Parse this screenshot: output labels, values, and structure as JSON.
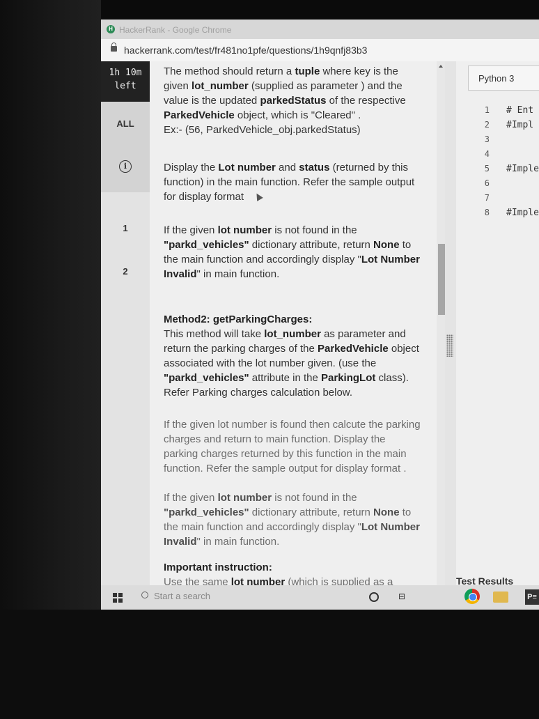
{
  "browser": {
    "window_title": "HackerRank - Google Chrome",
    "logo_letter": "H",
    "url": "hackerrank.com/test/fr481no1pfe/questions/1h9qnfj83b3"
  },
  "sidebar": {
    "timer": [
      "1h 10m",
      "left"
    ],
    "items": [
      {
        "label": "ALL"
      },
      {
        "label": "i"
      },
      {
        "label": "1"
      },
      {
        "label": "2"
      }
    ]
  },
  "content": {
    "p1": {
      "a": "The method should return a ",
      "b": "tuple",
      "c": " where key is the given ",
      "d": "lot_number",
      "e": " (supplied as parameter ) and the value is the updated ",
      "f": "parkedStatus",
      "g": " of the respective ",
      "h": "ParkedVehicle",
      "i": " object, which is \"Cleared\" .",
      "j": "Ex:- (56, ParkedVehicle_obj.parkedStatus)"
    },
    "p2": {
      "a": "Display the ",
      "b": "Lot number",
      "c": " and ",
      "d": "status",
      "e": " (returned by this function) in the main function. Refer the sample output for display format"
    },
    "p3": {
      "a": "If the given ",
      "b": "lot number",
      "c": " is not found in the ",
      "d": "\"parkd_vehicles\"",
      "e": " dictionary attribute, return ",
      "f": "None",
      "g": " to the main function and accordingly display \"",
      "h": "Lot Number Invalid",
      "i": "\" in main function."
    },
    "method2": {
      "heading": "Method2: getParkingCharges:",
      "a": "This method will take ",
      "b": "lot_number",
      "c": " as parameter and return the parking charges of the ",
      "d": "ParkedVehicle",
      "e": " object associated with the lot number given. (use the ",
      "f": "\"parkd_vehicles\"",
      "g": " attribute in the ",
      "h": "ParkingLot",
      "i": " class). Refer Parking charges calculation below."
    },
    "p5": "If the given lot number is found then calcute the parking charges and return to main function. Display the parking charges returned by this function in the main function. Refer the sample output for display format .",
    "p6": {
      "a": "If the given ",
      "b": "lot number",
      "c": " is not found in the ",
      "d": "\"parkd_vehicles\"",
      "e": " dictionary attribute, return ",
      "f": "None",
      "g": " to the main function and accordingly display \"",
      "h": "Lot Number Invalid",
      "i": "\" in main function."
    },
    "important": {
      "heading": "Important instruction:",
      "a": "Use the same ",
      "b": "lot number",
      "c": " (which is supplied as a"
    }
  },
  "editor": {
    "language": "Python 3",
    "lines": [
      {
        "n": "1",
        "text": "# Ent"
      },
      {
        "n": "2",
        "text": "#Impl"
      },
      {
        "n": "3",
        "text": ""
      },
      {
        "n": "4",
        "text": ""
      },
      {
        "n": "5",
        "text": "#Imple"
      },
      {
        "n": "6",
        "text": ""
      },
      {
        "n": "7",
        "text": ""
      },
      {
        "n": "8",
        "text": "#Imple"
      }
    ],
    "test_results": "Test Results"
  },
  "taskbar": {
    "search_placeholder": "Start a search",
    "ppt_label": "P≡"
  }
}
